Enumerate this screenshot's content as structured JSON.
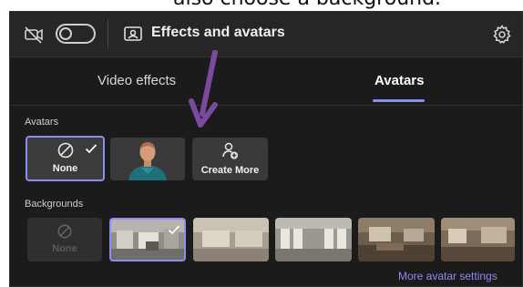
{
  "caption": {
    "text": "also choose a background."
  },
  "toolbar": {
    "title": "Effects and avatars",
    "icons": {
      "camera": "camera-off-icon",
      "effects": "effects-icon",
      "settings": "gear-icon"
    }
  },
  "tabs": [
    {
      "label": "Video effects",
      "selected": false
    },
    {
      "label": "Avatars",
      "selected": true
    }
  ],
  "avatars": {
    "label": "Avatars",
    "items": [
      {
        "label": "None",
        "selected": true
      },
      {
        "label": "",
        "selected": false
      },
      {
        "label": "Create More",
        "selected": false
      }
    ]
  },
  "backgrounds": {
    "label": "Backgrounds",
    "none_label": "None",
    "selected_index": 1
  },
  "more_link": "More avatar settings",
  "colors": {
    "accent": "#8b8cf0",
    "annotation_arrow": "#7b4a9e",
    "panel": "#1b1b1b",
    "toolbar": "#262626"
  }
}
